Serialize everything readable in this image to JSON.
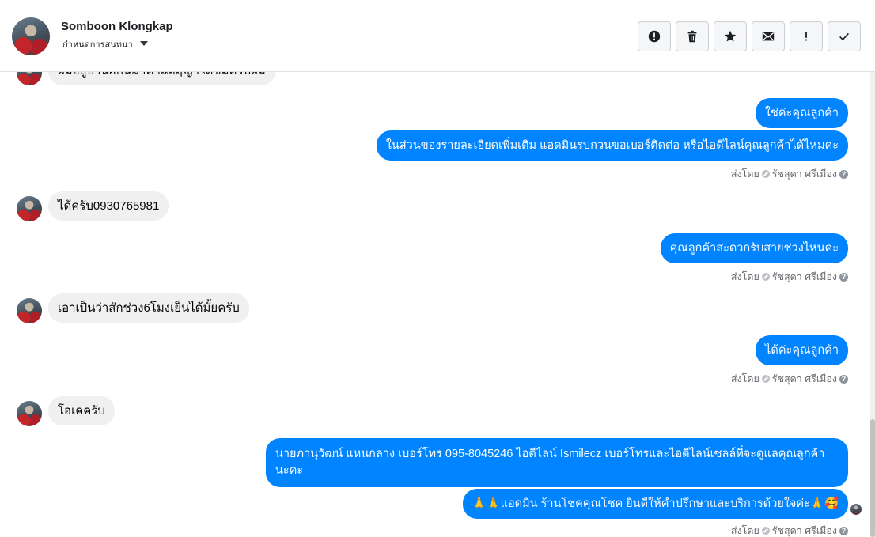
{
  "header": {
    "contact_name": "Somboon Klongkap",
    "sub_label": "กำหนดการสนทนา",
    "actions": [
      {
        "name": "report-icon",
        "label": "report"
      },
      {
        "name": "trash-icon",
        "label": "delete"
      },
      {
        "name": "star-icon",
        "label": "star"
      },
      {
        "name": "envelope-icon",
        "label": "mark unread"
      },
      {
        "name": "exclamation-icon",
        "label": "spam"
      },
      {
        "name": "check-icon",
        "label": "done"
      }
    ]
  },
  "messages": [
    {
      "dir": "in",
      "text": "ผมอยู่บ้านสกนมาคำแลฤญาได้ขึ้มครับผม"
    },
    {
      "dir": "out",
      "text": "ใช่ค่ะคุณลูกค้า"
    },
    {
      "dir": "out",
      "text": "ในส่วนของรายละเอียดเพิ่มเติม แอดมินรบกวนขอเบอร์ติดต่อ หรือไอดีไลน์คุณลูกค้าได้ไหมคะ"
    },
    {
      "dir": "in",
      "text": "ได้ครับ0930765981"
    },
    {
      "dir": "out",
      "text": "คุณลูกค้าสะดวกรับสายช่วงไหนค่ะ"
    },
    {
      "dir": "in",
      "text": "เอาเป็นว่าสักช่วง6โมงเย็นได้มั้ยครับ"
    },
    {
      "dir": "out",
      "text": "ได้ค่ะคุณลูกค้า"
    },
    {
      "dir": "in",
      "text": "โอเคครับ"
    },
    {
      "dir": "out",
      "text": "นายภานุวัฒน์ แหนกลาง เบอร์โทร 095-8045246 ไอดีไลน์ Ismilecz   เบอร์โทรและไอดีไลน์เซลล์ที่จะดูแลคุณลูกค้านะคะ"
    },
    {
      "dir": "out",
      "text": "🙏🙏แอดมิน ร้านโชคคุณโชค ยินดีให้คำปรึกษาและบริการด้วยใจค่ะ🙏🥰"
    }
  ],
  "sent_by": {
    "prefix": "ส่งโดย",
    "agent": "รัชสุดา ศรีเมือง",
    "help": "?"
  },
  "colors": {
    "outgoing": "#0084ff",
    "incoming": "#f0f0f0"
  }
}
